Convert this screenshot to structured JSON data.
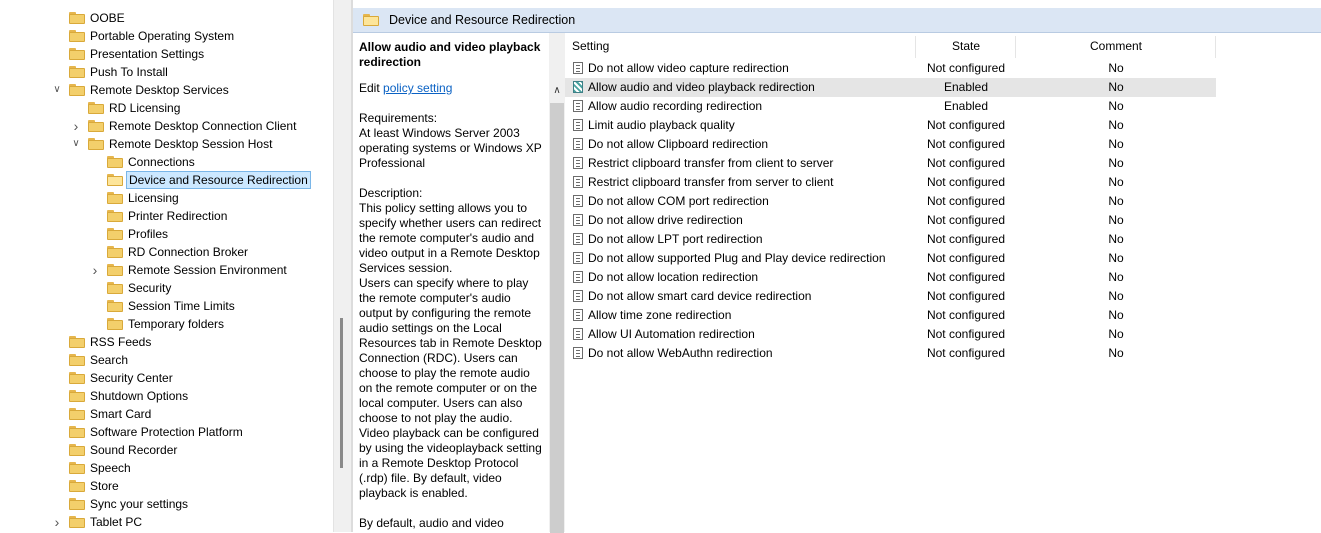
{
  "tree": {
    "items": [
      {
        "label": "OOBE",
        "expander": ""
      },
      {
        "label": "Portable Operating System",
        "expander": ""
      },
      {
        "label": "Presentation Settings",
        "expander": ""
      },
      {
        "label": "Push To Install",
        "expander": ""
      },
      {
        "label": "Remote Desktop Services",
        "expander": "expanded"
      },
      {
        "label": "RD Licensing",
        "expander": ""
      },
      {
        "label": "Remote Desktop Connection Client",
        "expander": "collapsed"
      },
      {
        "label": "Remote Desktop Session Host",
        "expander": "expanded"
      },
      {
        "label": "Connections",
        "expander": ""
      },
      {
        "label": "Device and Resource Redirection",
        "expander": "",
        "selected": true
      },
      {
        "label": "Licensing",
        "expander": ""
      },
      {
        "label": "Printer Redirection",
        "expander": ""
      },
      {
        "label": "Profiles",
        "expander": ""
      },
      {
        "label": "RD Connection Broker",
        "expander": ""
      },
      {
        "label": "Remote Session Environment",
        "expander": "collapsed"
      },
      {
        "label": "Security",
        "expander": ""
      },
      {
        "label": "Session Time Limits",
        "expander": ""
      },
      {
        "label": "Temporary folders",
        "expander": ""
      },
      {
        "label": "RSS Feeds",
        "expander": ""
      },
      {
        "label": "Search",
        "expander": ""
      },
      {
        "label": "Security Center",
        "expander": ""
      },
      {
        "label": "Shutdown Options",
        "expander": ""
      },
      {
        "label": "Smart Card",
        "expander": ""
      },
      {
        "label": "Software Protection Platform",
        "expander": ""
      },
      {
        "label": "Sound Recorder",
        "expander": ""
      },
      {
        "label": "Speech",
        "expander": ""
      },
      {
        "label": "Store",
        "expander": ""
      },
      {
        "label": "Sync your settings",
        "expander": ""
      },
      {
        "label": "Tablet PC",
        "expander": "collapsed"
      }
    ]
  },
  "header": {
    "title": "Device and Resource Redirection",
    "icon": "folder-icon"
  },
  "description": {
    "title": "Allow audio and video playback redirection",
    "edit_prefix": "Edit",
    "edit_link": "policy setting",
    "requirements_label": "Requirements:",
    "requirements_text": "At least Windows Server 2003 operating systems or Windows XP Professional",
    "description_label": "Description:",
    "description_p1": "This policy setting allows you to specify whether users can redirect the remote computer's audio and video output in a Remote Desktop Services session.",
    "description_p2": "Users can specify where to play the remote computer's audio output by configuring the remote audio settings on the Local Resources tab in Remote Desktop Connection (RDC). Users can choose to play the remote audio on the remote computer or on the local computer. Users can also choose to not play the audio. Video playback can be configured by using the videoplayback setting in a Remote Desktop Protocol (.rdp) file. By default, video playback is enabled.",
    "description_p3": "By default, audio and video"
  },
  "list": {
    "columns": {
      "setting": "Setting",
      "state": "State",
      "comment": "Comment"
    },
    "rows": [
      {
        "name": "Do not allow video capture redirection",
        "state": "Not configured",
        "comment": "No"
      },
      {
        "name": "Allow audio and video playback redirection",
        "state": "Enabled",
        "comment": "No",
        "selected": true
      },
      {
        "name": "Allow audio recording redirection",
        "state": "Enabled",
        "comment": "No"
      },
      {
        "name": "Limit audio playback quality",
        "state": "Not configured",
        "comment": "No"
      },
      {
        "name": "Do not allow Clipboard redirection",
        "state": "Not configured",
        "comment": "No"
      },
      {
        "name": "Restrict clipboard transfer from client to server",
        "state": "Not configured",
        "comment": "No"
      },
      {
        "name": "Restrict clipboard transfer from server to client",
        "state": "Not configured",
        "comment": "No"
      },
      {
        "name": "Do not allow COM port redirection",
        "state": "Not configured",
        "comment": "No"
      },
      {
        "name": "Do not allow drive redirection",
        "state": "Not configured",
        "comment": "No"
      },
      {
        "name": "Do not allow LPT port redirection",
        "state": "Not configured",
        "comment": "No"
      },
      {
        "name": "Do not allow supported Plug and Play device redirection",
        "state": "Not configured",
        "comment": "No"
      },
      {
        "name": "Do not allow location redirection",
        "state": "Not configured",
        "comment": "No"
      },
      {
        "name": "Do not allow smart card device redirection",
        "state": "Not configured",
        "comment": "No"
      },
      {
        "name": "Allow time zone redirection",
        "state": "Not configured",
        "comment": "No"
      },
      {
        "name": "Allow UI Automation redirection",
        "state": "Not configured",
        "comment": "No"
      },
      {
        "name": "Do not allow WebAuthn redirection",
        "state": "Not configured",
        "comment": "No"
      }
    ]
  },
  "icons": {
    "expander_expanded": "chevron-down-icon",
    "expander_collapsed": "chevron-right-icon",
    "policy": "policy-setting-icon"
  },
  "colors": {
    "header_band": "#dbe6f4",
    "selection_bg": "#cce8ff",
    "row_highlight": "#e5e5e5",
    "link": "#0b62c4",
    "folder": "#f3cf6b"
  }
}
